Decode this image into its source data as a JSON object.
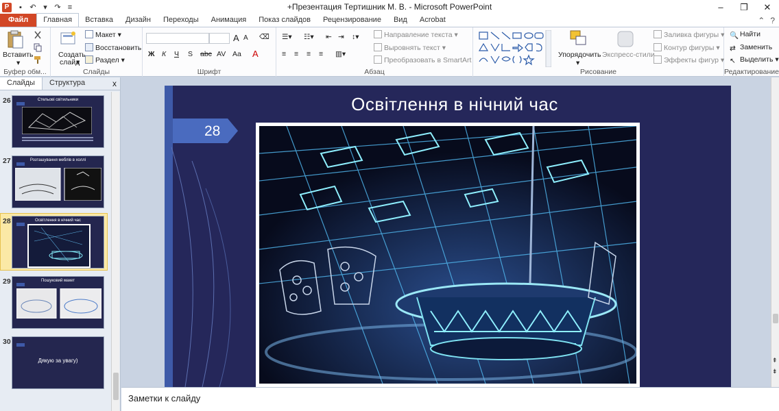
{
  "window": {
    "title": "+Презентация Тертишник  М. В.  -  Microsoft PowerPoint",
    "app_icon_letter": "P",
    "controls": [
      "–",
      "❐",
      "✕"
    ]
  },
  "tabs": [
    "Файл",
    "Главная",
    "Вставка",
    "Дизайн",
    "Переходы",
    "Анимация",
    "Показ слайдов",
    "Рецензирование",
    "Вид",
    "Acrobat"
  ],
  "active_tab": "Главная",
  "ribbon": {
    "clipboard": {
      "paste": "Вставить",
      "label": "Буфер обм..."
    },
    "slides": {
      "new_slide_1": "Создать",
      "new_slide_2": "слайд",
      "layout": "Макет",
      "reset": "Восстановить",
      "section": "Раздел",
      "label": "Слайды"
    },
    "font": {
      "label": "Шрифт",
      "bold": "Ж",
      "italic": "К",
      "underline": "Ч",
      "shadow": "S",
      "strike": "abc",
      "spacing": "AV",
      "case": "Aa",
      "grow": "A",
      "shrink": "A"
    },
    "paragraph": {
      "label": "Абзац",
      "text_direction": "Направление текста",
      "align_text": "Выровнять текст",
      "smartart": "Преобразовать в SmartArt"
    },
    "drawing": {
      "label": "Рисование",
      "arrange": "Упорядочить",
      "quick_styles": "Экспресс-стили",
      "fill": "Заливка фигуры",
      "outline": "Контур фигуры",
      "effects": "Эффекты фигур"
    },
    "editing": {
      "label": "Редактирование",
      "find": "Найти",
      "replace": "Заменить",
      "select": "Выделить"
    }
  },
  "left_pane": {
    "tabs": [
      "Слайды",
      "Структура"
    ],
    "active_tab": "Слайды",
    "close": "x",
    "thumbnails": [
      {
        "number": "26",
        "title": "Стельові  світильники",
        "body": ""
      },
      {
        "number": "27",
        "title": "Розташування  меблів  в  холлі",
        "body": ""
      },
      {
        "number": "28",
        "title": "Освітлення  в  нічний  час",
        "body": "",
        "selected": true
      },
      {
        "number": "29",
        "title": "Пошуковий  макет",
        "body": ""
      },
      {
        "number": "30",
        "title": "",
        "body": "Дякую за увагу)"
      }
    ]
  },
  "slide": {
    "title": "Освітлення в нічний час",
    "number": "28"
  },
  "notes": {
    "placeholder": "Заметки к слайду"
  },
  "colors": {
    "file_tab": "#d24726",
    "slide_bg": "#25275a",
    "accent_arrow": "#4a6bbf",
    "selected_thumb": "#fbe9a6"
  }
}
